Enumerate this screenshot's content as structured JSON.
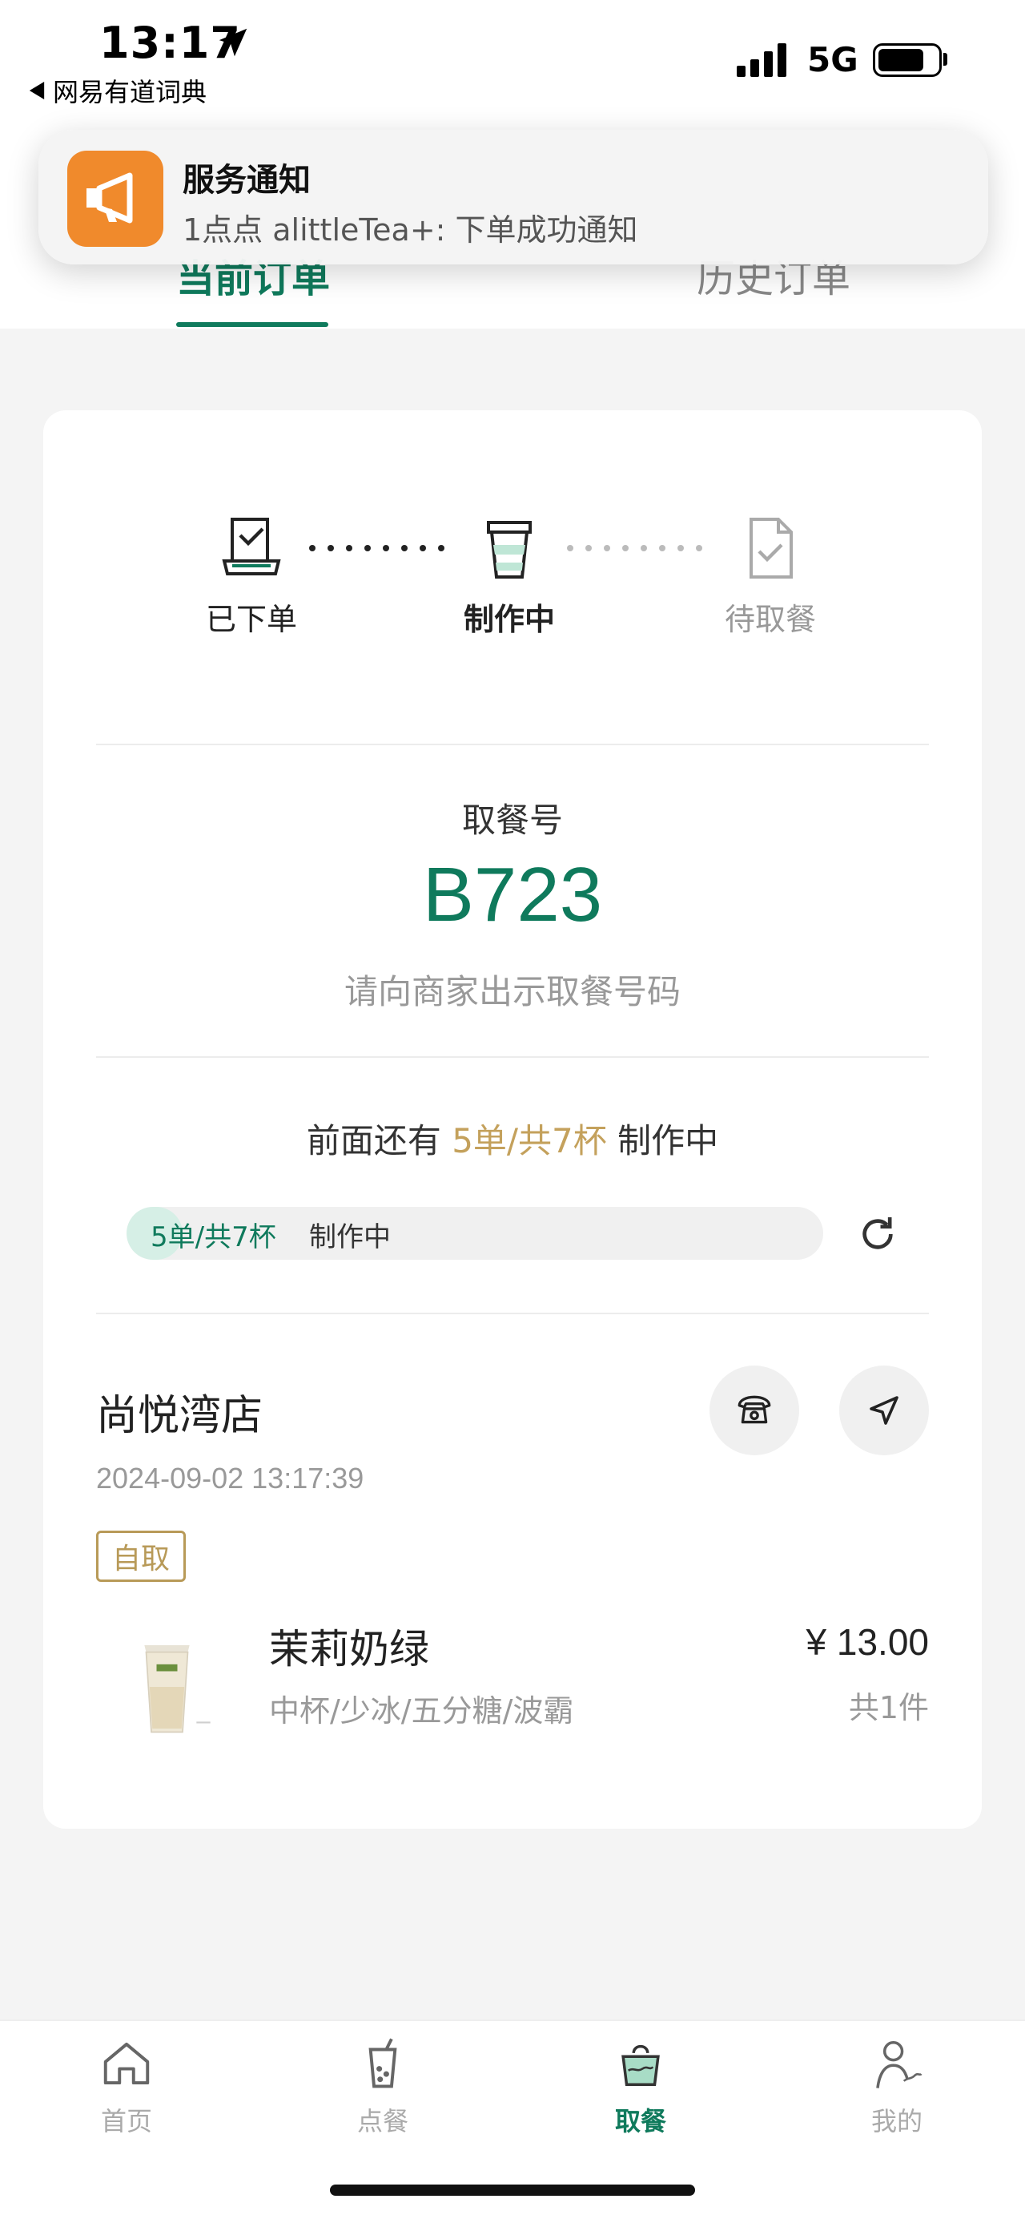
{
  "status_bar": {
    "time": "13:17",
    "back_app": "网易有道词典",
    "network": "5G"
  },
  "notification": {
    "icon": "megaphone-icon",
    "title": "服务通知",
    "body": "1点点 alittleTea+: 下单成功通知"
  },
  "tabs": [
    {
      "label": "当前订单",
      "active": true
    },
    {
      "label": "历史订单",
      "active": false
    }
  ],
  "progress_steps": [
    {
      "label": "已下单",
      "icon": "order-placed-icon",
      "state": "done"
    },
    {
      "label": "制作中",
      "icon": "cup-icon",
      "state": "current"
    },
    {
      "label": "待取餐",
      "icon": "pickup-check-icon",
      "state": "pending"
    }
  ],
  "pickup": {
    "label": "取餐号",
    "number": "B723",
    "hint": "请向商家出示取餐号码"
  },
  "queue": {
    "prefix": "前面还有",
    "highlight": "5单/共7杯",
    "suffix": "制作中",
    "bar_count": "5单/共7杯",
    "bar_status": "制作中",
    "bar_progress": 0.08
  },
  "store": {
    "name": "尚悦湾店",
    "datetime": "2024-09-02 13:17:39",
    "tag": "自取"
  },
  "product": {
    "name": "茉莉奶绿",
    "options": "中杯/少冰/五分糖/波霸",
    "price": "¥ 13.00",
    "quantity": "共1件"
  },
  "nav": [
    {
      "label": "首页",
      "icon": "home-icon",
      "active": false
    },
    {
      "label": "点餐",
      "icon": "drink-icon",
      "active": false
    },
    {
      "label": "取餐",
      "icon": "takeout-icon",
      "active": true
    },
    {
      "label": "我的",
      "icon": "profile-icon",
      "active": false
    }
  ],
  "colors": {
    "brand": "#0f7a5c",
    "accent_gold": "#c4a15c",
    "notification_icon": "#f08a2c"
  }
}
